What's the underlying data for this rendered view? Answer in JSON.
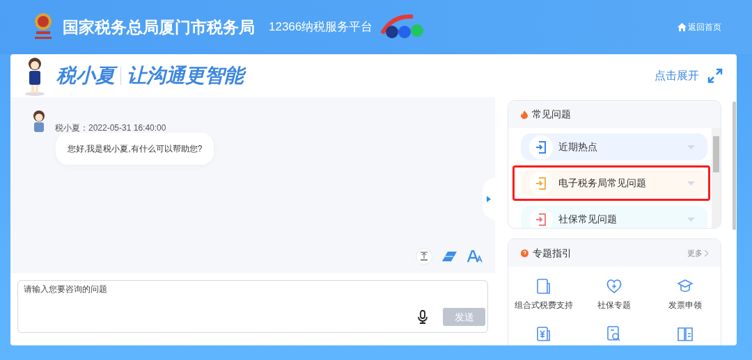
{
  "header": {
    "title": "国家税务总局厦门市税务局",
    "platform": "12366纳税服务平台",
    "home_link": "返回首页"
  },
  "banner": {
    "brand": "税小夏",
    "slogan": "让沟通更智能",
    "expand": "点击展开"
  },
  "chat": {
    "messages": [
      {
        "meta": "税小夏：2022-05-31 16:40:00",
        "text": "您好,我是税小夏,有什么可以帮助您?"
      }
    ],
    "input": {
      "placeholder": "请输入您要咨询的问题"
    },
    "send": {
      "label": "发送",
      "disabled": true
    }
  },
  "faq": {
    "title": "常见问题",
    "items": [
      {
        "label": "近期热点",
        "color": "#3b82f6",
        "highlighted": false
      },
      {
        "label": "电子税务局常见问题",
        "color": "#f5b041",
        "highlighted": true
      },
      {
        "label": "社保常见问题",
        "color": "#ef7d7d",
        "highlighted": false
      }
    ]
  },
  "guide": {
    "title": "专题指引",
    "more": "更多",
    "items": [
      {
        "label": "组合式税费支持",
        "kind": "tax"
      },
      {
        "label": "社保专题",
        "kind": "heart"
      },
      {
        "label": "发票申领",
        "kind": "cap"
      },
      {
        "kind": "yuan"
      },
      {
        "kind": "search"
      },
      {
        "kind": "book"
      }
    ]
  }
}
